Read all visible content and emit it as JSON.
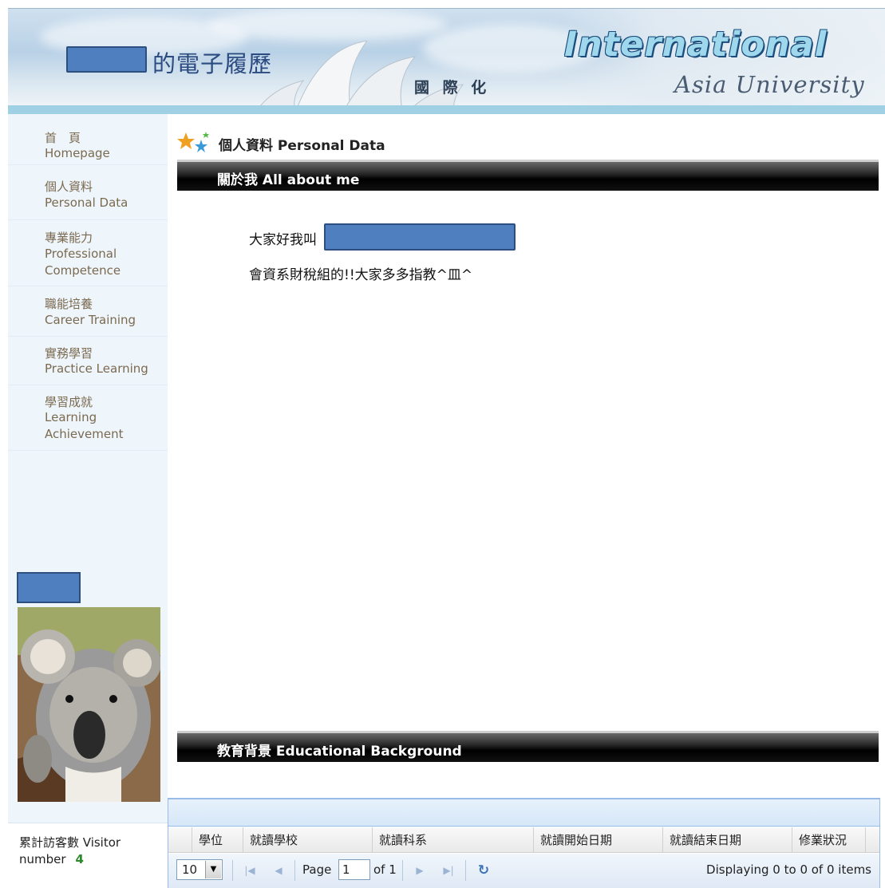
{
  "header": {
    "title_cn": "的電子履歷",
    "intl_cn": "國 際 化",
    "brand_en": "International",
    "university_en": "Asia University"
  },
  "sidebar": {
    "items": [
      {
        "cn": "首　頁",
        "en": "Homepage"
      },
      {
        "cn": "個人資料",
        "en": "Personal Data"
      },
      {
        "cn": "專業能力",
        "en": "Professional Competence"
      },
      {
        "cn": "職能培養",
        "en": "Career Training"
      },
      {
        "cn": "實務學習",
        "en": "Practice Learning"
      },
      {
        "cn": "學習成就",
        "en": "Learning Achievement"
      }
    ],
    "visitor_label": "累計訪客數 Visitor number",
    "visitor_count": "4"
  },
  "main": {
    "section_title": "個人資料 Personal Data",
    "about_header": "關於我 All about me",
    "about_line1": "大家好我叫",
    "about_line2": "會資系財稅組的!!大家多多指教^皿^",
    "education_header": "教育背景 Educational Background"
  },
  "grid": {
    "columns": [
      "學位",
      "就讀學校",
      "就讀科系",
      "就讀開始日期",
      "就讀結束日期",
      "修業狀況"
    ],
    "page_size": "10",
    "page_label": "Page",
    "page_value": "1",
    "of_label": "of 1",
    "display_text": "Displaying 0 to 0 of 0 items"
  },
  "colors": {
    "redaction": "#4f7fbf",
    "nav_text": "#7b6a50",
    "sidebar_bg": "#eef5fb",
    "visitor_count": "#2a8a2a"
  },
  "icons": {
    "section": "stars-icon",
    "first": "first-page-icon",
    "prev": "prev-page-icon",
    "next": "next-page-icon",
    "last": "last-page-icon",
    "refresh": "refresh-icon",
    "dropdown": "chevron-down-icon"
  }
}
